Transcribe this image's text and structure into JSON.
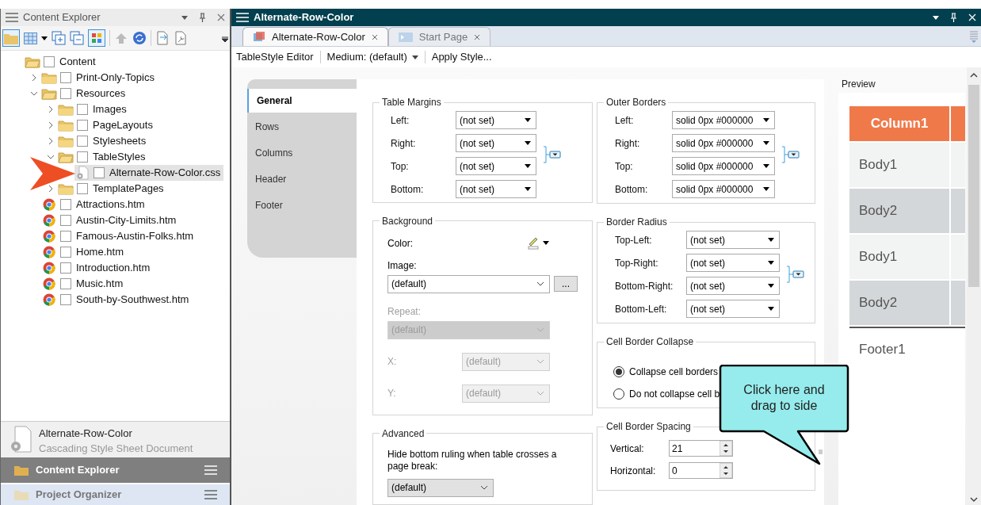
{
  "explorer": {
    "title": "Content Explorer",
    "tree": [
      {
        "label": "Content",
        "kind": "folder",
        "checked": false,
        "selected": false,
        "children": [
          {
            "label": "Print-Only-Topics",
            "kind": "folder",
            "expanded": false,
            "checked": false,
            "selected": false
          },
          {
            "label": "Resources",
            "kind": "folder",
            "expanded": true,
            "checked": false,
            "selected": false,
            "children": [
              {
                "label": "Images",
                "kind": "folder",
                "expanded": false,
                "checked": false,
                "selected": false
              },
              {
                "label": "PageLayouts",
                "kind": "folder",
                "expanded": false,
                "checked": false,
                "selected": false
              },
              {
                "label": "Stylesheets",
                "kind": "folder",
                "expanded": false,
                "checked": false,
                "selected": false
              },
              {
                "label": "TableStyles",
                "kind": "folder",
                "expanded": true,
                "checked": false,
                "selected": false,
                "children": [
                  {
                    "label": "Alternate-Row-Color.css",
                    "kind": "stylesheet",
                    "checked": false,
                    "selected": true
                  }
                ]
              },
              {
                "label": "TemplatePages",
                "kind": "folder",
                "expanded": false,
                "checked": false,
                "selected": false
              }
            ]
          },
          {
            "label": "Attractions.htm",
            "kind": "page",
            "checked": false,
            "selected": false
          },
          {
            "label": "Austin-City-Limits.htm",
            "kind": "page",
            "checked": false,
            "selected": false
          },
          {
            "label": "Famous-Austin-Folks.htm",
            "kind": "page",
            "checked": false,
            "selected": false
          },
          {
            "label": "Home.htm",
            "kind": "page",
            "checked": false,
            "selected": false
          },
          {
            "label": "Introduction.htm",
            "kind": "page",
            "checked": false,
            "selected": false
          },
          {
            "label": "Music.htm",
            "kind": "page",
            "checked": false,
            "selected": false
          },
          {
            "label": "South-by-Southwest.htm",
            "kind": "page",
            "checked": false,
            "selected": false
          }
        ]
      }
    ],
    "details": {
      "name": "Alternate-Row-Color",
      "type": "Cascading Style Sheet Document"
    },
    "panes": [
      {
        "label": "Content Explorer",
        "selected": true
      },
      {
        "label": "Project Organizer",
        "selected": false
      }
    ]
  },
  "editor": {
    "title": "Alternate-Row-Color",
    "tabs": [
      {
        "label": "Alternate-Row-Color",
        "kind": "tablestyle",
        "selected": true
      },
      {
        "label": "Start Page",
        "kind": "start",
        "selected": false
      }
    ],
    "toolbar": [
      {
        "label": "TableStyle Editor",
        "kind": "text"
      },
      {
        "label": "Medium: (default)",
        "kind": "dropdown"
      },
      {
        "label": "Apply Style...",
        "kind": "button"
      }
    ],
    "sections": [
      {
        "label": "General",
        "selected": true
      },
      {
        "label": "Rows",
        "selected": false
      },
      {
        "label": "Columns",
        "selected": false
      },
      {
        "label": "Header",
        "selected": false
      },
      {
        "label": "Footer",
        "selected": false
      }
    ],
    "table_margins": {
      "title": "Table Margins",
      "fields": [
        {
          "label": "Left:",
          "value": "(not set)"
        },
        {
          "label": "Right:",
          "value": "(not set)"
        },
        {
          "label": "Top:",
          "value": "(not set)"
        },
        {
          "label": "Bottom:",
          "value": "(not set)"
        }
      ]
    },
    "background": {
      "title": "Background",
      "color_label": "Color:",
      "image": {
        "label": "Image:",
        "value": "(default)",
        "browse": "..."
      },
      "repeat": {
        "label": "Repeat:",
        "value": "(default)",
        "disabled": true
      },
      "x": {
        "label": "X:",
        "value": "(default)",
        "disabled": true
      },
      "y": {
        "label": "Y:",
        "value": "(default)",
        "disabled": true
      }
    },
    "advanced": {
      "title": "Advanced",
      "label": "Hide bottom ruling when table crosses a page break:",
      "value": "(default)"
    },
    "outer_borders": {
      "title": "Outer Borders",
      "fields": [
        {
          "label": "Left:",
          "value": "solid 0px #000000"
        },
        {
          "label": "Right:",
          "value": "solid 0px #000000"
        },
        {
          "label": "Top:",
          "value": "solid 0px #000000"
        },
        {
          "label": "Bottom:",
          "value": "solid 0px #000000"
        }
      ]
    },
    "border_radius": {
      "title": "Border Radius",
      "fields": [
        {
          "label": "Top-Left:",
          "value": "(not set)"
        },
        {
          "label": "Top-Right:",
          "value": "(not set)"
        },
        {
          "label": "Bottom-Right:",
          "value": "(not set)"
        },
        {
          "label": "Bottom-Left:",
          "value": "(not set)"
        }
      ]
    },
    "cell_border_collapse": {
      "title": "Cell Border Collapse",
      "options": [
        {
          "label": "Collapse cell borders",
          "selected": true
        },
        {
          "label": "Do not collapse cell b",
          "selected": false
        }
      ]
    },
    "cell_border_spacing": {
      "title": "Cell Border Spacing",
      "fields": [
        {
          "label": "Vertical:",
          "value": "21"
        },
        {
          "label": "Horizontal:",
          "value": "0"
        }
      ]
    },
    "preview": {
      "title": "Preview",
      "rows": [
        {
          "kind": "header",
          "text": "Column1"
        },
        {
          "kind": "odd",
          "text": "Body1"
        },
        {
          "kind": "even",
          "text": "Body2"
        },
        {
          "kind": "odd",
          "text": "Body1"
        },
        {
          "kind": "even",
          "text": "Body2"
        },
        {
          "kind": "footer",
          "text": "Footer1"
        }
      ]
    }
  },
  "callout": {
    "text": "Click here and drag to side"
  }
}
